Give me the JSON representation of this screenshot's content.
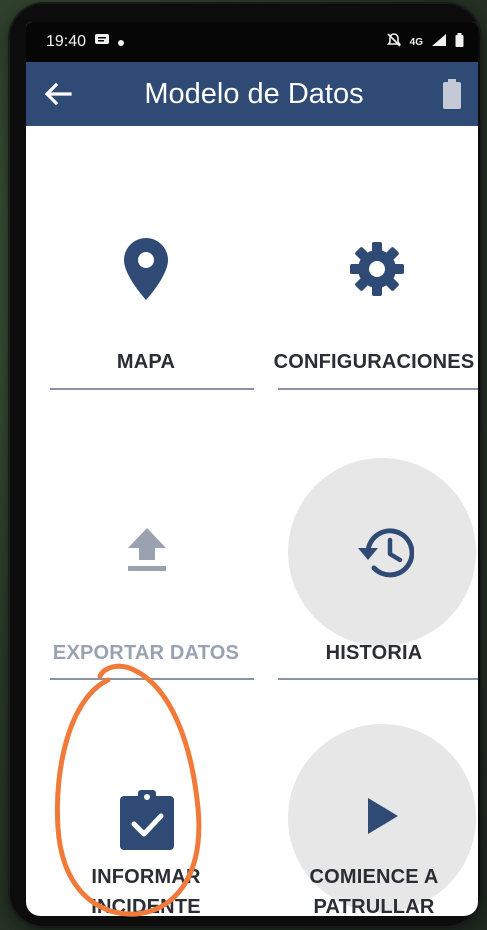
{
  "status_bar": {
    "time": "19:40",
    "network": "4G",
    "left_icons": [
      "message-icon",
      "dot-icon"
    ],
    "right_icons": [
      "mute-icon",
      "signal-icon",
      "battery-icon"
    ]
  },
  "app_bar": {
    "title": "Modelo de Datos",
    "back_icon": "arrow-left-icon",
    "right_icon": "battery-icon"
  },
  "tiles": [
    {
      "id": "map",
      "label": "MAPA",
      "icon": "map-pin-icon",
      "enabled": true
    },
    {
      "id": "settings",
      "label": "CONFIGURACIONES",
      "icon": "gear-icon",
      "enabled": true
    },
    {
      "id": "export",
      "label": "EXPORTAR DATOS",
      "icon": "upload-icon",
      "enabled": false
    },
    {
      "id": "history",
      "label": "HISTORIA",
      "icon": "history-icon",
      "enabled": true,
      "highlighted": true
    },
    {
      "id": "incident",
      "label_line1": "INFORMAR",
      "label_line2": "INCIDENTE",
      "icon": "clipboard-check-icon",
      "enabled": true
    },
    {
      "id": "patrol",
      "label_line1": "COMIENCE A",
      "label_line2": "PATRULLAR",
      "icon": "play-icon",
      "enabled": true,
      "highlighted": true
    }
  ],
  "colors": {
    "app_bar": "#2f4a75",
    "icon": "#2f4a75",
    "icon_disabled": "#9aa2b1",
    "annotation": "#f07a3a"
  }
}
